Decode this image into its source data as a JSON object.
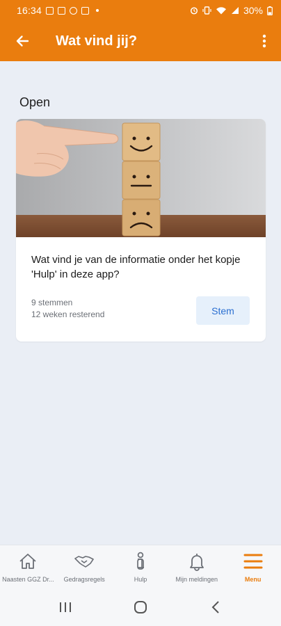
{
  "status_bar": {
    "time": "16:34",
    "battery": "30%",
    "icons": [
      "gallery-icon",
      "gallery-icon",
      "whatsapp-icon",
      "box-app-icon",
      "alarm-icon",
      "vibrate-icon",
      "wifi-icon",
      "signal-icon",
      "battery-icon"
    ]
  },
  "app_bar": {
    "title": "Wat vind jij?",
    "back_icon": "arrow-left-icon",
    "more_icon": "more-vertical-icon"
  },
  "section": {
    "title": "Open"
  },
  "poll_card": {
    "image": "wooden-smiley-blocks",
    "question": "Wat vind je van de informatie onder het kopje 'Hulp' in deze app?",
    "votes": "9 stemmen",
    "remaining": "12 weken resterend",
    "button_label": "Stem"
  },
  "bottom_nav": {
    "items": [
      {
        "label": "Naasten GGZ Dr...",
        "icon": "home-icon"
      },
      {
        "label": "Gedragsregels",
        "icon": "handshake-icon"
      },
      {
        "label": "Hulp",
        "icon": "info-icon"
      },
      {
        "label": "Mijn meldingen",
        "icon": "bell-icon"
      },
      {
        "label": "Menu",
        "icon": "menu-icon",
        "active": true
      }
    ]
  },
  "system_nav": {
    "icons": [
      "recent-apps-icon",
      "home-circle-icon",
      "back-chevron-icon"
    ]
  },
  "colors": {
    "brand": "#ea7d0e",
    "background": "#eaeef5",
    "button_bg": "#e6f0fb",
    "button_text": "#2b6fd1"
  }
}
